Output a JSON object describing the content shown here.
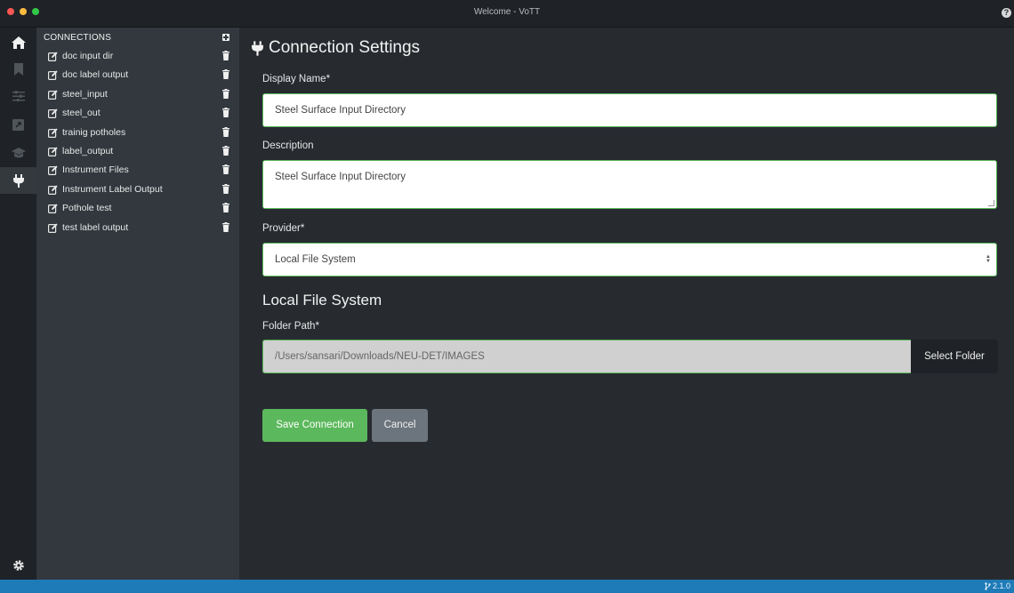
{
  "window": {
    "title": "Welcome - VoTT"
  },
  "rail": {
    "items": [
      {
        "icon": "home-icon",
        "active": true
      },
      {
        "icon": "bookmark-icon",
        "active": false
      },
      {
        "icon": "sliders-icon",
        "active": false
      },
      {
        "icon": "export-icon",
        "active": false
      },
      {
        "icon": "graduation-cap-icon",
        "active": false
      },
      {
        "icon": "plug-icon",
        "active": true
      }
    ],
    "settings_icon": "gear-icon"
  },
  "sidebar": {
    "header": "CONNECTIONS",
    "items": [
      {
        "label": "doc input dir"
      },
      {
        "label": "doc label output"
      },
      {
        "label": "steel_input"
      },
      {
        "label": "steel_out"
      },
      {
        "label": "trainig potholes"
      },
      {
        "label": "label_output"
      },
      {
        "label": "Instrument Files"
      },
      {
        "label": "Instrument Label Output"
      },
      {
        "label": "Pothole test"
      },
      {
        "label": "test label output"
      }
    ]
  },
  "main": {
    "title": "Connection Settings",
    "display_name_label": "Display Name*",
    "display_name_value": "Steel Surface Input Directory",
    "description_label": "Description",
    "description_value": "Steel Surface Input Directory",
    "provider_label": "Provider*",
    "provider_value": "Local File System",
    "section_title": "Local File System",
    "folder_path_label": "Folder Path*",
    "folder_path_value": "/Users/sansari/Downloads/NEU-DET/IMAGES",
    "select_folder_label": "Select Folder",
    "save_label": "Save Connection",
    "cancel_label": "Cancel"
  },
  "status": {
    "version": "2.1.0"
  },
  "colors": {
    "accent": "#5cb85c",
    "status_bar": "#1e7bb8",
    "sidebar": "#32383e",
    "background": "#272b30"
  }
}
